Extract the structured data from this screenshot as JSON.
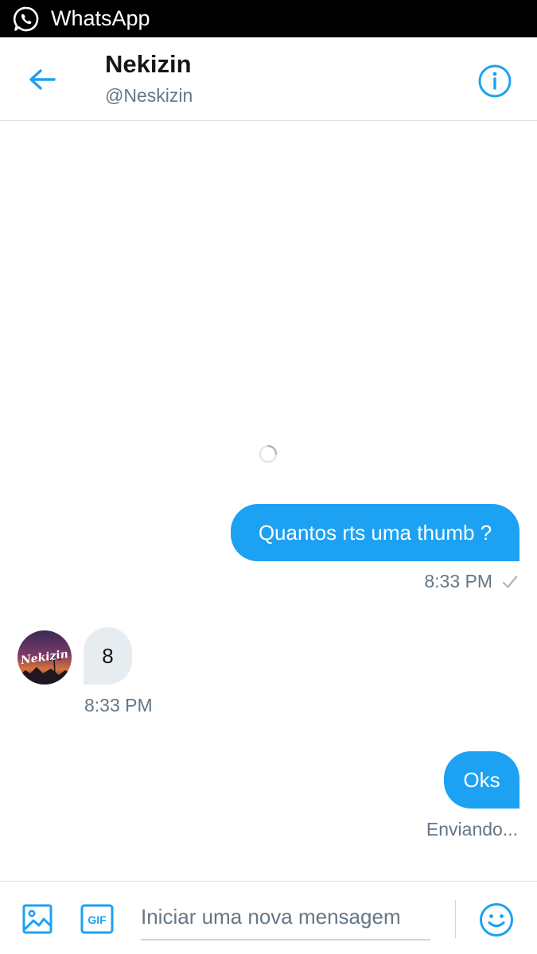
{
  "status_bar": {
    "app_name": "WhatsApp",
    "icon": "whatsapp-icon"
  },
  "header": {
    "title": "Nekizin",
    "handle": "@Neskizin",
    "back_icon": "arrow-left-icon",
    "info_icon": "info-icon"
  },
  "messages": [
    {
      "direction": "outgoing",
      "text": "Quantos rts uma thumb ?",
      "time": "8:33 PM",
      "status_icon": "check-icon"
    },
    {
      "direction": "incoming",
      "text": "8",
      "time": "8:33 PM",
      "avatar_text": "Nekizin"
    },
    {
      "direction": "outgoing",
      "text": "Oks",
      "status": "Enviando..."
    }
  ],
  "composer": {
    "placeholder": "Iniciar uma nova mensagem",
    "value": "",
    "gif_label": "GIF",
    "image_icon": "image-icon",
    "emoji_icon": "emoji-icon"
  },
  "colors": {
    "accent": "#1da1f2",
    "incoming_bubble": "#e6ecf0",
    "secondary_text": "#657786",
    "status_bar": "#000000"
  }
}
